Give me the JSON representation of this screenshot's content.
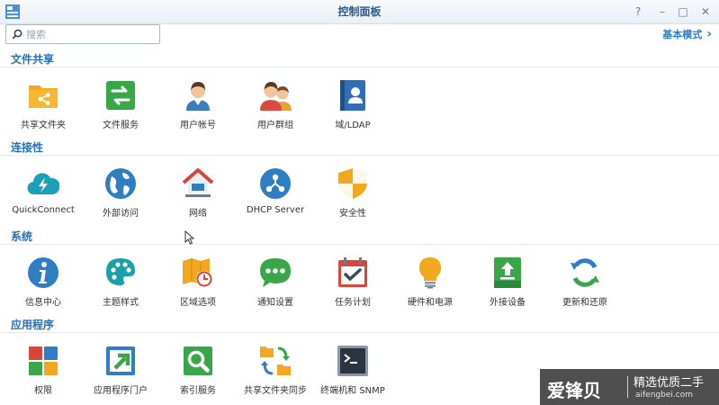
{
  "window": {
    "title": "控制面板",
    "help_glyph": "?",
    "minimize_glyph": "–",
    "maximize_glyph": "□",
    "close_glyph": "✕"
  },
  "search": {
    "placeholder": "搜索",
    "value": ""
  },
  "mode_link": {
    "label": "基本模式",
    "chevron": "›"
  },
  "sections": [
    {
      "title": "文件共享",
      "items": [
        {
          "label": "共享文件夹",
          "icon": "shared-folder-icon"
        },
        {
          "label": "文件服务",
          "icon": "file-services-icon"
        },
        {
          "label": "用户帐号",
          "icon": "user-icon"
        },
        {
          "label": "用户群组",
          "icon": "group-icon"
        },
        {
          "label": "域/LDAP",
          "icon": "domain-ldap-icon"
        }
      ]
    },
    {
      "title": "连接性",
      "items": [
        {
          "label": "QuickConnect",
          "icon": "quickconnect-icon"
        },
        {
          "label": "外部访问",
          "icon": "external-access-icon"
        },
        {
          "label": "网络",
          "icon": "network-icon"
        },
        {
          "label": "DHCP Server",
          "icon": "dhcp-server-icon"
        },
        {
          "label": "安全性",
          "icon": "security-icon"
        }
      ]
    },
    {
      "title": "系统",
      "items": [
        {
          "label": "信息中心",
          "icon": "info-center-icon"
        },
        {
          "label": "主题样式",
          "icon": "theme-icon"
        },
        {
          "label": "区域选项",
          "icon": "regional-options-icon"
        },
        {
          "label": "通知设置",
          "icon": "notification-icon"
        },
        {
          "label": "任务计划",
          "icon": "task-scheduler-icon"
        },
        {
          "label": "硬件和电源",
          "icon": "hardware-power-icon"
        },
        {
          "label": "外接设备",
          "icon": "external-devices-icon"
        },
        {
          "label": "更新和还原",
          "icon": "update-restore-icon"
        }
      ]
    },
    {
      "title": "应用程序",
      "items": [
        {
          "label": "权限",
          "icon": "privileges-icon"
        },
        {
          "label": "应用程序门户",
          "icon": "application-portal-icon"
        },
        {
          "label": "索引服务",
          "icon": "indexing-service-icon"
        },
        {
          "label": "共享文件夹同步",
          "icon": "shared-folder-sync-icon"
        },
        {
          "label": "终端机和 SNMP",
          "icon": "terminal-snmp-icon"
        }
      ]
    }
  ],
  "watermark": {
    "logo": "爱锋贝",
    "slogan": "精选优质二手",
    "url": "aifengbei.com"
  },
  "colors": {
    "accent": "#2f7dc3",
    "section_title": "#2a6fb1"
  }
}
